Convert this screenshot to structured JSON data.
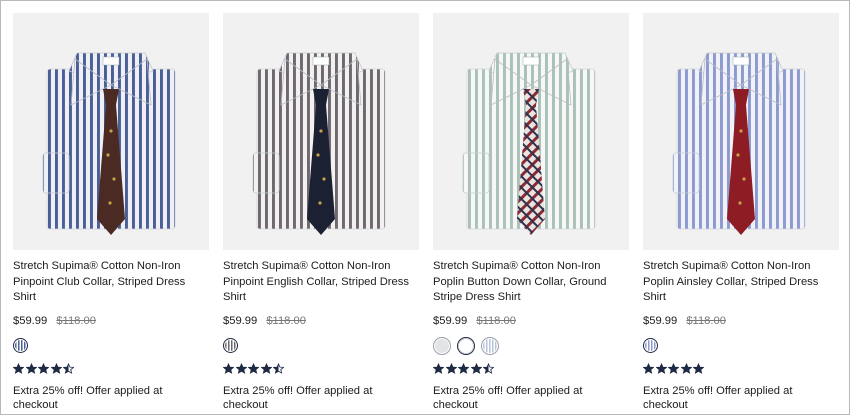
{
  "products": [
    {
      "title": "Stretch Supima® Cotton Non-Iron Pinpoint Club Collar, Striped Dress Shirt",
      "price": "$59.99",
      "original_price": "$118.00",
      "swatches": [
        {
          "style": "blue-stripe",
          "selected": true
        }
      ],
      "rating": 4.5,
      "promo": "Extra 25% off! Offer applied at checkout",
      "shirt_colors": {
        "stripe": "#4a5f96",
        "base": "#eef0f5",
        "tie": "#4a2a22"
      }
    },
    {
      "title": "Stretch Supima® Cotton Non-Iron Pinpoint English Collar, Striped Dress Shirt",
      "price": "$59.99",
      "original_price": "$118.00",
      "swatches": [
        {
          "style": "brown-blue-stripe",
          "selected": true
        }
      ],
      "rating": 4.5,
      "promo": "Extra 25% off! Offer applied at checkout",
      "shirt_colors": {
        "stripe": "#6f6870",
        "base": "#f2f1f0",
        "tie": "#1b2032"
      }
    },
    {
      "title": "Stretch Supima® Cotton Non-Iron Poplin Button Down Collar, Ground Stripe Dress Shirt",
      "price": "$59.99",
      "original_price": "$118.00",
      "swatches": [
        {
          "style": "grey-light",
          "selected": false
        },
        {
          "style": "white",
          "selected": true
        },
        {
          "style": "blue-light",
          "selected": false
        }
      ],
      "rating": 4.5,
      "promo": "Extra 25% off! Offer applied at checkout",
      "shirt_colors": {
        "stripe": "#a9c2b8",
        "base": "#f6f7f6",
        "tie": "plaid"
      }
    },
    {
      "title": "Stretch Supima® Cotton Non-Iron Poplin Ainsley Collar, Striped Dress Shirt",
      "price": "$59.99",
      "original_price": "$118.00",
      "swatches": [
        {
          "style": "lavender-stripe",
          "selected": true
        }
      ],
      "rating": 5,
      "promo": "Extra 25% off! Offer applied at checkout",
      "shirt_colors": {
        "stripe": "#8c9ad0",
        "base": "#f1f2f8",
        "tie": "#8e1c24"
      }
    }
  ],
  "colors": {
    "star": "#1f2a44",
    "accent_navy": "#1f2a44"
  }
}
